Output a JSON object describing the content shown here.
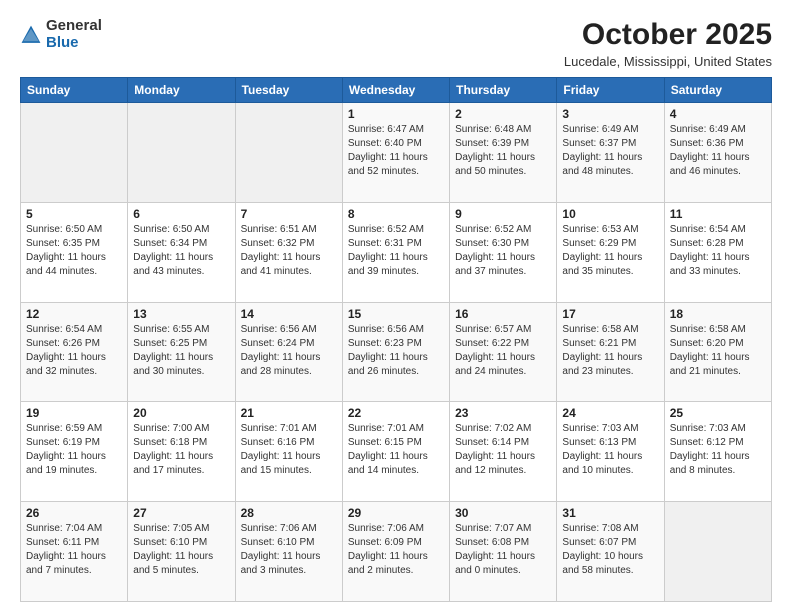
{
  "logo": {
    "general": "General",
    "blue": "Blue"
  },
  "header": {
    "title": "October 2025",
    "subtitle": "Lucedale, Mississippi, United States"
  },
  "days_of_week": [
    "Sunday",
    "Monday",
    "Tuesday",
    "Wednesday",
    "Thursday",
    "Friday",
    "Saturday"
  ],
  "weeks": [
    [
      {
        "day": "",
        "info": ""
      },
      {
        "day": "",
        "info": ""
      },
      {
        "day": "",
        "info": ""
      },
      {
        "day": "1",
        "info": "Sunrise: 6:47 AM\nSunset: 6:40 PM\nDaylight: 11 hours\nand 52 minutes."
      },
      {
        "day": "2",
        "info": "Sunrise: 6:48 AM\nSunset: 6:39 PM\nDaylight: 11 hours\nand 50 minutes."
      },
      {
        "day": "3",
        "info": "Sunrise: 6:49 AM\nSunset: 6:37 PM\nDaylight: 11 hours\nand 48 minutes."
      },
      {
        "day": "4",
        "info": "Sunrise: 6:49 AM\nSunset: 6:36 PM\nDaylight: 11 hours\nand 46 minutes."
      }
    ],
    [
      {
        "day": "5",
        "info": "Sunrise: 6:50 AM\nSunset: 6:35 PM\nDaylight: 11 hours\nand 44 minutes."
      },
      {
        "day": "6",
        "info": "Sunrise: 6:50 AM\nSunset: 6:34 PM\nDaylight: 11 hours\nand 43 minutes."
      },
      {
        "day": "7",
        "info": "Sunrise: 6:51 AM\nSunset: 6:32 PM\nDaylight: 11 hours\nand 41 minutes."
      },
      {
        "day": "8",
        "info": "Sunrise: 6:52 AM\nSunset: 6:31 PM\nDaylight: 11 hours\nand 39 minutes."
      },
      {
        "day": "9",
        "info": "Sunrise: 6:52 AM\nSunset: 6:30 PM\nDaylight: 11 hours\nand 37 minutes."
      },
      {
        "day": "10",
        "info": "Sunrise: 6:53 AM\nSunset: 6:29 PM\nDaylight: 11 hours\nand 35 minutes."
      },
      {
        "day": "11",
        "info": "Sunrise: 6:54 AM\nSunset: 6:28 PM\nDaylight: 11 hours\nand 33 minutes."
      }
    ],
    [
      {
        "day": "12",
        "info": "Sunrise: 6:54 AM\nSunset: 6:26 PM\nDaylight: 11 hours\nand 32 minutes."
      },
      {
        "day": "13",
        "info": "Sunrise: 6:55 AM\nSunset: 6:25 PM\nDaylight: 11 hours\nand 30 minutes."
      },
      {
        "day": "14",
        "info": "Sunrise: 6:56 AM\nSunset: 6:24 PM\nDaylight: 11 hours\nand 28 minutes."
      },
      {
        "day": "15",
        "info": "Sunrise: 6:56 AM\nSunset: 6:23 PM\nDaylight: 11 hours\nand 26 minutes."
      },
      {
        "day": "16",
        "info": "Sunrise: 6:57 AM\nSunset: 6:22 PM\nDaylight: 11 hours\nand 24 minutes."
      },
      {
        "day": "17",
        "info": "Sunrise: 6:58 AM\nSunset: 6:21 PM\nDaylight: 11 hours\nand 23 minutes."
      },
      {
        "day": "18",
        "info": "Sunrise: 6:58 AM\nSunset: 6:20 PM\nDaylight: 11 hours\nand 21 minutes."
      }
    ],
    [
      {
        "day": "19",
        "info": "Sunrise: 6:59 AM\nSunset: 6:19 PM\nDaylight: 11 hours\nand 19 minutes."
      },
      {
        "day": "20",
        "info": "Sunrise: 7:00 AM\nSunset: 6:18 PM\nDaylight: 11 hours\nand 17 minutes."
      },
      {
        "day": "21",
        "info": "Sunrise: 7:01 AM\nSunset: 6:16 PM\nDaylight: 11 hours\nand 15 minutes."
      },
      {
        "day": "22",
        "info": "Sunrise: 7:01 AM\nSunset: 6:15 PM\nDaylight: 11 hours\nand 14 minutes."
      },
      {
        "day": "23",
        "info": "Sunrise: 7:02 AM\nSunset: 6:14 PM\nDaylight: 11 hours\nand 12 minutes."
      },
      {
        "day": "24",
        "info": "Sunrise: 7:03 AM\nSunset: 6:13 PM\nDaylight: 11 hours\nand 10 minutes."
      },
      {
        "day": "25",
        "info": "Sunrise: 7:03 AM\nSunset: 6:12 PM\nDaylight: 11 hours\nand 8 minutes."
      }
    ],
    [
      {
        "day": "26",
        "info": "Sunrise: 7:04 AM\nSunset: 6:11 PM\nDaylight: 11 hours\nand 7 minutes."
      },
      {
        "day": "27",
        "info": "Sunrise: 7:05 AM\nSunset: 6:10 PM\nDaylight: 11 hours\nand 5 minutes."
      },
      {
        "day": "28",
        "info": "Sunrise: 7:06 AM\nSunset: 6:10 PM\nDaylight: 11 hours\nand 3 minutes."
      },
      {
        "day": "29",
        "info": "Sunrise: 7:06 AM\nSunset: 6:09 PM\nDaylight: 11 hours\nand 2 minutes."
      },
      {
        "day": "30",
        "info": "Sunrise: 7:07 AM\nSunset: 6:08 PM\nDaylight: 11 hours\nand 0 minutes."
      },
      {
        "day": "31",
        "info": "Sunrise: 7:08 AM\nSunset: 6:07 PM\nDaylight: 10 hours\nand 58 minutes."
      },
      {
        "day": "",
        "info": ""
      }
    ]
  ]
}
